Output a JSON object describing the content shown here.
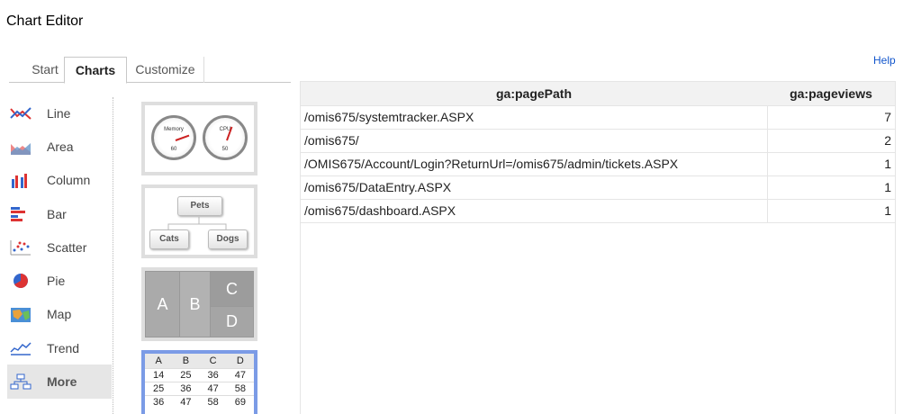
{
  "window": {
    "title": "Chart Editor"
  },
  "tabs": [
    {
      "label": "Start"
    },
    {
      "label": "Charts"
    },
    {
      "label": "Customize"
    }
  ],
  "help_label": "Help",
  "chart_types": [
    {
      "label": "Line",
      "icon": "line-chart-icon"
    },
    {
      "label": "Area",
      "icon": "area-chart-icon"
    },
    {
      "label": "Column",
      "icon": "column-chart-icon"
    },
    {
      "label": "Bar",
      "icon": "bar-chart-icon"
    },
    {
      "label": "Scatter",
      "icon": "scatter-chart-icon"
    },
    {
      "label": "Pie",
      "icon": "pie-chart-icon"
    },
    {
      "label": "Map",
      "icon": "map-chart-icon"
    },
    {
      "label": "Trend",
      "icon": "trend-chart-icon"
    },
    {
      "label": "More",
      "icon": "org-chart-icon"
    }
  ],
  "selected_type": "More",
  "thumbnails": {
    "gauge": {
      "labels": [
        "Memory",
        "CPU"
      ],
      "ticks": [
        "60",
        "50"
      ]
    },
    "org": {
      "root": "Pets",
      "children": [
        "Cats",
        "Dogs"
      ]
    },
    "treemap": {
      "labels": [
        "A",
        "B",
        "C",
        "D"
      ]
    },
    "table": {
      "headers": [
        "A",
        "B",
        "C",
        "D"
      ],
      "rows": [
        [
          "14",
          "25",
          "36",
          "47"
        ],
        [
          "25",
          "36",
          "47",
          "58"
        ],
        [
          "36",
          "47",
          "58",
          "69"
        ]
      ]
    }
  },
  "data_table": {
    "headers": [
      "ga:pagePath",
      "ga:pageviews"
    ],
    "rows": [
      [
        "/omis675/systemtracker.ASPX",
        "7"
      ],
      [
        "/omis675/",
        "2"
      ],
      [
        "/OMIS675/Account/Login?ReturnUrl=/omis675/admin/tickets.ASPX",
        "1"
      ],
      [
        "/omis675/DataEntry.ASPX",
        "1"
      ],
      [
        "/omis675/dashboard.ASPX",
        "1"
      ]
    ]
  },
  "colors": {
    "accent": "#1155cc",
    "selected_thumb_border": "#7b9be6"
  }
}
